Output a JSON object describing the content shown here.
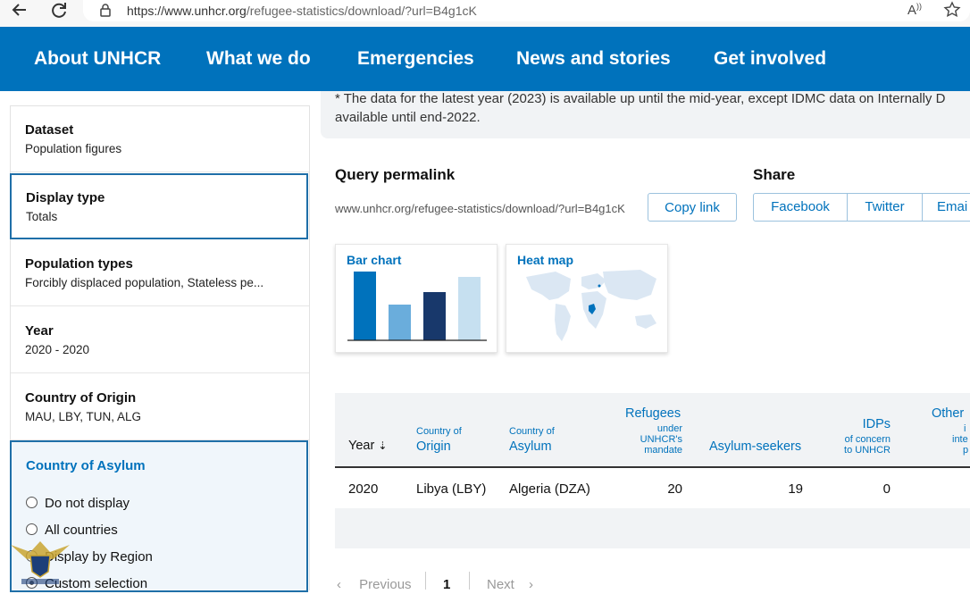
{
  "browser": {
    "url_domain": "https://www.unhcr.org",
    "url_path": "/refugee-statistics/download/?url=B4g1cK"
  },
  "nav": {
    "items": [
      "About UNHCR",
      "What we do",
      "Emergencies",
      "News and stories",
      "Get involved"
    ]
  },
  "notice": {
    "line1": "* The data for the latest year (2023) is available up until the mid-year, except IDMC data on Internally D",
    "line2": "available until end-2022."
  },
  "filters": [
    {
      "title": "Dataset",
      "value": "Population figures"
    },
    {
      "title": "Display type",
      "value": "Totals"
    },
    {
      "title": "Population types",
      "value": "Forcibly displaced population, Stateless pe..."
    },
    {
      "title": "Year",
      "value": "2020 - 2020"
    },
    {
      "title": "Country of Origin",
      "value": "MAU, LBY, TUN, ALG"
    }
  ],
  "asylum": {
    "title": "Country of Asylum",
    "options": [
      "Do not display",
      "All countries",
      "Display by Region",
      "Custom selection"
    ],
    "selected": 3
  },
  "permalink": {
    "title": "Query permalink",
    "url": "www.unhcr.org/refugee-statistics/download/?url=B4g1cK",
    "copy_label": "Copy link"
  },
  "share": {
    "title": "Share",
    "buttons": [
      "Facebook",
      "Twitter",
      "Emai"
    ]
  },
  "visualizations": {
    "bar_chart_label": "Bar chart",
    "heat_map_label": "Heat map"
  },
  "colors": {
    "brand_blue": "#0072bc",
    "dark_navy": "#18386b",
    "light_blue": "#6aaddc",
    "pale_blue": "#c6e0f0"
  },
  "table": {
    "headers": {
      "year": "Year",
      "origin_small": "Country of",
      "origin_main": "Origin",
      "asylum_small": "Country of",
      "asylum_main": "Asylum",
      "refugees_main": "Refugees",
      "refugees_sub1": "under",
      "refugees_sub2": "UNHCR's",
      "refugees_sub3": "mandate",
      "asylum_seekers": "Asylum-seekers",
      "idps_main": "IDPs",
      "idps_sub1": "of concern",
      "idps_sub2": "to UNHCR",
      "other_main": "Other",
      "other_sub1": "i",
      "other_sub2": "inte",
      "other_sub3": "p"
    },
    "rows": [
      {
        "year": "2020",
        "origin": "Libya (LBY)",
        "asylum": "Algeria (DZA)",
        "refugees": "20",
        "asylum_seekers": "19",
        "idps": "0"
      }
    ]
  },
  "pagination": {
    "previous": "Previous",
    "current": "1",
    "next": "Next"
  }
}
